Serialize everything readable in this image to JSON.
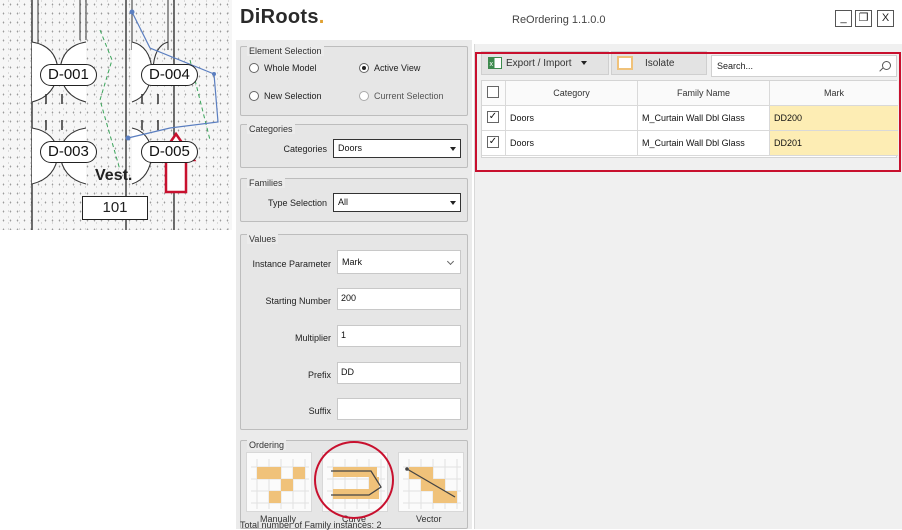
{
  "plan": {
    "door_tags": [
      "D-001",
      "D-004",
      "D-003",
      "D-005"
    ],
    "room_name": "Vest.",
    "room_number": "101"
  },
  "app": {
    "logo": "DiRoots",
    "window_title": "ReOrdering 1.1.0.0",
    "window_buttons": {
      "minimize": "_",
      "restore": "❐",
      "close": "X"
    }
  },
  "element_selection": {
    "legend": "Element Selection",
    "options": [
      {
        "label": "Whole Model",
        "checked": false,
        "enabled": true
      },
      {
        "label": "Active View",
        "checked": true,
        "enabled": true
      },
      {
        "label": "New Selection",
        "checked": false,
        "enabled": true
      },
      {
        "label": "Current Selection",
        "checked": false,
        "enabled": false
      }
    ]
  },
  "categories": {
    "legend": "Categories",
    "label": "Categories",
    "value": "Doors"
  },
  "families": {
    "legend": "Families",
    "label": "Type Selection",
    "value": "All"
  },
  "values": {
    "legend": "Values",
    "instance_parameter": {
      "label": "Instance Parameter",
      "value": "Mark"
    },
    "starting_number": {
      "label": "Starting Number",
      "value": "200"
    },
    "multiplier": {
      "label": "Multiplier",
      "value": "1"
    },
    "prefix": {
      "label": "Prefix",
      "value": "DD"
    },
    "suffix": {
      "label": "Suffix",
      "value": ""
    }
  },
  "ordering": {
    "legend": "Ordering",
    "options": [
      "Manually",
      "Curve",
      "Vector"
    ],
    "selected": "Curve"
  },
  "status": {
    "total_instances": "Total number of Family instances: 2"
  },
  "toolbar": {
    "export_import": "Export / Import",
    "isolate": "Isolate",
    "search_placeholder": "Search..."
  },
  "grid": {
    "columns": [
      "Category",
      "Family Name",
      "Mark"
    ],
    "rows": [
      {
        "checked": true,
        "category": "Doors",
        "family": "M_Curtain Wall Dbl Glass",
        "mark": "DD200"
      },
      {
        "checked": true,
        "category": "Doors",
        "family": "M_Curtain Wall Dbl Glass",
        "mark": "DD201"
      }
    ]
  },
  "colors": {
    "highlight_red": "#c8102e",
    "mark_cell_bg": "#fdedb4",
    "tile_orange": "#f0c27a",
    "logo_accent": "#e0a030"
  }
}
